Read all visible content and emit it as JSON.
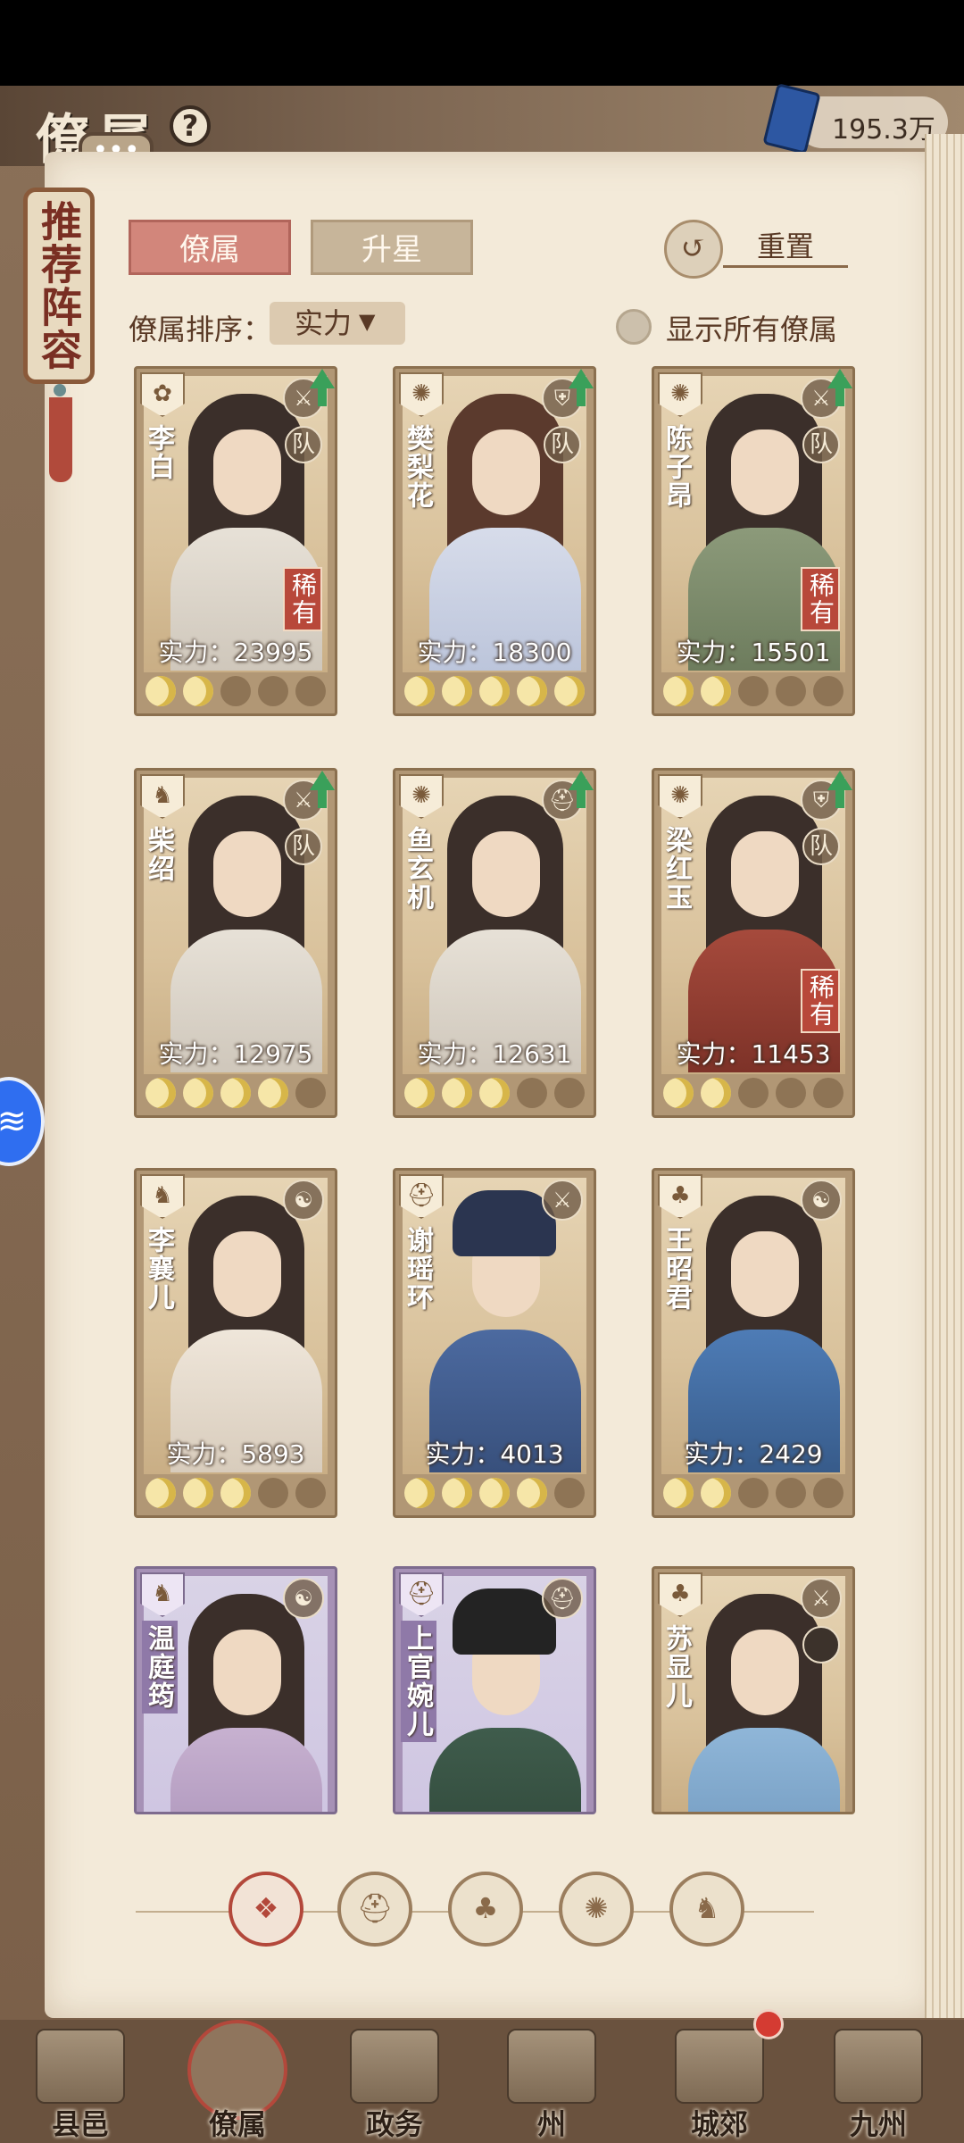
{
  "header": {
    "title": "僚属",
    "currency_value": "195.3万"
  },
  "side_banner": {
    "text": "推荐阵容"
  },
  "tabs": {
    "active": "僚属",
    "inactive": "升星"
  },
  "reset_label": "重置",
  "sort": {
    "label": "僚属排序：",
    "selected": "实力"
  },
  "show_all_label": "显示所有僚属",
  "team_badge": "队",
  "rare_label": "稀有",
  "cards": [
    {
      "name": "李白",
      "power_text": "实力：23995",
      "stars": 2,
      "upgrade": true,
      "rare": true
    },
    {
      "name": "樊梨花",
      "power_text": "实力：18300",
      "stars": 5,
      "upgrade": true,
      "rare": false
    },
    {
      "name": "陈子昂",
      "power_text": "实力：15501",
      "stars": 2,
      "upgrade": true,
      "rare": true
    },
    {
      "name": "柴绍",
      "power_text": "实力：12975",
      "stars": 4,
      "upgrade": true,
      "rare": false
    },
    {
      "name": "鱼玄机",
      "power_text": "实力：12631",
      "stars": 3,
      "upgrade": true,
      "rare": false
    },
    {
      "name": "梁红玉",
      "power_text": "实力：11453",
      "stars": 2,
      "upgrade": true,
      "rare": true
    },
    {
      "name": "李襄儿",
      "power_text": "实力：5893",
      "stars": 3,
      "upgrade": false,
      "rare": false
    },
    {
      "name": "谢瑶环",
      "power_text": "实力：4013",
      "stars": 4,
      "upgrade": false,
      "rare": false
    },
    {
      "name": "王昭君",
      "power_text": "实力：2429",
      "stars": 2,
      "upgrade": false,
      "rare": false
    },
    {
      "name": "温庭筠"
    },
    {
      "name": "上官婉儿"
    },
    {
      "name": "苏显儿"
    }
  ],
  "nav": [
    {
      "label": "县邑"
    },
    {
      "label": "僚属"
    },
    {
      "label": "政务"
    },
    {
      "label": "州"
    },
    {
      "label": "城郊"
    },
    {
      "label": "九州"
    }
  ],
  "colors": {
    "accent_red": "#b3483b",
    "upgrade_green": "#3aa05a",
    "tab_active": "#d2867b"
  }
}
